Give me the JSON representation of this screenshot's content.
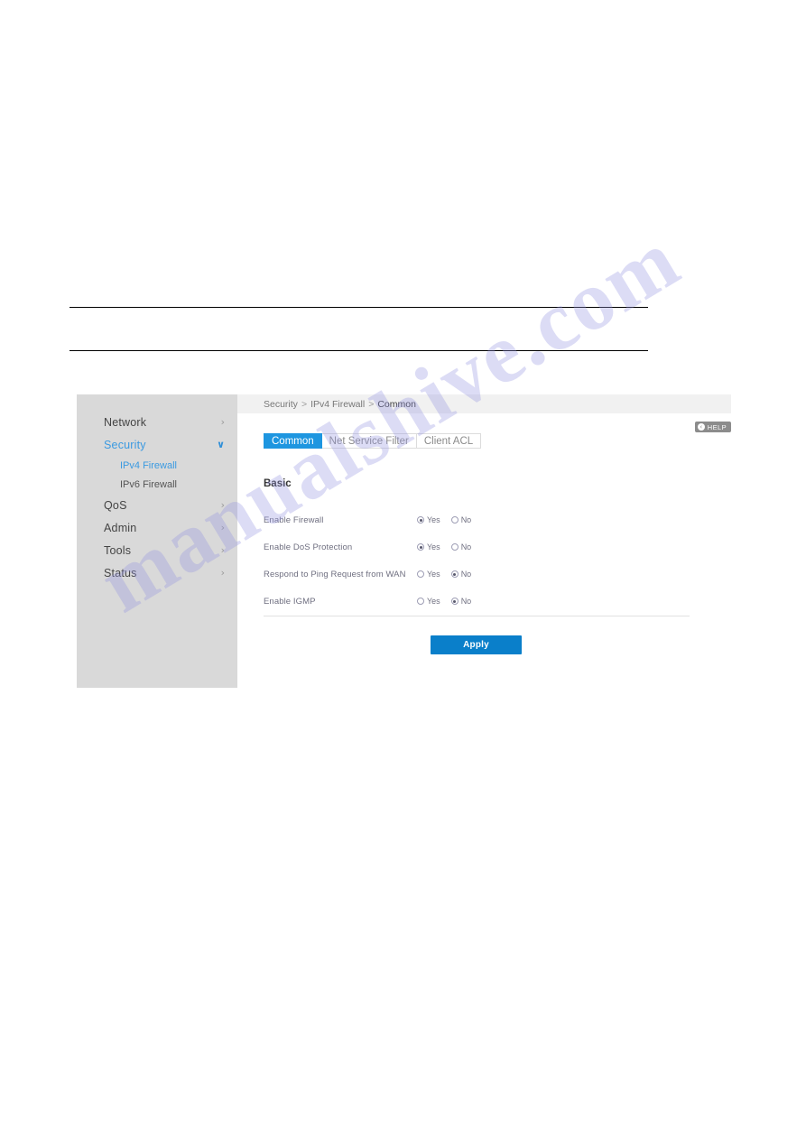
{
  "document": {
    "watermark_text": "manualshive.com"
  },
  "router_ui": {
    "breadcrumb": {
      "items": [
        "Security",
        "IPv4 Firewall",
        "Common"
      ],
      "separator": ">"
    },
    "help": {
      "label": "HELP",
      "icon": "back-circle-icon",
      "glyph": "‹"
    },
    "sidebar": {
      "items": [
        {
          "label": "Network",
          "chevron": "›",
          "expanded": false,
          "active": false
        },
        {
          "label": "Security",
          "chevron": "∨",
          "expanded": true,
          "active": true
        },
        {
          "label": "QoS",
          "chevron": "›",
          "expanded": false,
          "active": false
        },
        {
          "label": "Admin",
          "chevron": "›",
          "expanded": false,
          "active": false
        },
        {
          "label": "Tools",
          "chevron": "›",
          "expanded": false,
          "active": false
        },
        {
          "label": "Status",
          "chevron": "›",
          "expanded": false,
          "active": false
        }
      ],
      "sub_items": [
        {
          "label": "IPv4 Firewall",
          "active": true
        },
        {
          "label": "IPv6 Firewall",
          "active": false
        }
      ]
    },
    "tabs": [
      {
        "label": "Common",
        "active": true
      },
      {
        "label": "Net Service Filter",
        "active": false
      },
      {
        "label": "Client ACL",
        "active": false
      }
    ],
    "section": {
      "title": "Basic",
      "rows": [
        {
          "label": "Enable Firewall",
          "yes_label": "Yes",
          "no_label": "No",
          "selected": "Yes"
        },
        {
          "label": "Enable DoS Protection",
          "yes_label": "Yes",
          "no_label": "No",
          "selected": "Yes"
        },
        {
          "label": "Respond to Ping Request from WAN",
          "yes_label": "Yes",
          "no_label": "No",
          "selected": "No"
        },
        {
          "label": "Enable IGMP",
          "yes_label": "Yes",
          "no_label": "No",
          "selected": "No"
        }
      ]
    },
    "apply_label": "Apply",
    "colors": {
      "accent": "#1e96e0",
      "button": "#0a7fca",
      "sidebar_bg": "#d9d9d9",
      "breadcrumb_bg": "#f1f1f1",
      "link": "#3b9ae1"
    }
  }
}
